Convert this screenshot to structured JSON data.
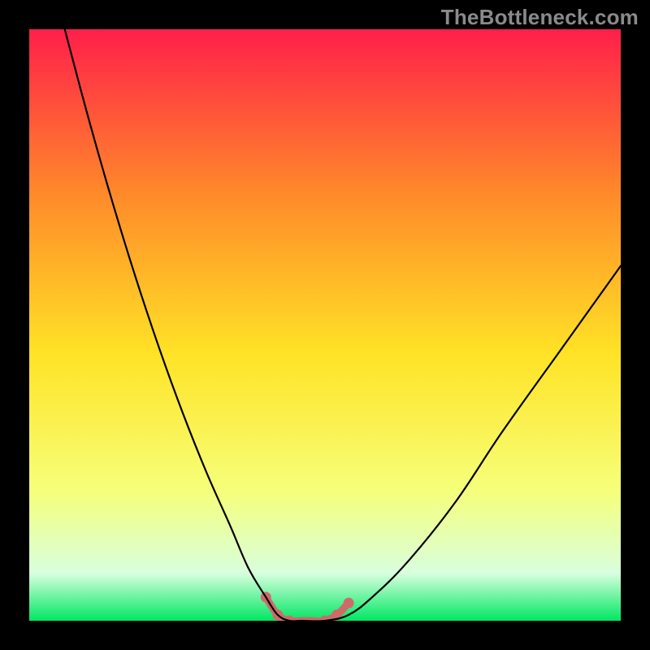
{
  "watermark": {
    "text": "TheBottleneck.com"
  },
  "chart_data": {
    "type": "line",
    "title": "",
    "xlabel": "",
    "ylabel": "",
    "xlim": [
      0,
      100
    ],
    "ylim": [
      0,
      100
    ],
    "background_gradient": {
      "top": "#ff1f4a",
      "mid_upper": "#ff8a2a",
      "mid": "#ffe326",
      "mid_lower": "#f6ff7a",
      "band": "#d8ffde",
      "bottom": "#00e763"
    },
    "series": [
      {
        "name": "bottleneck-curve",
        "x": [
          6,
          10,
          14,
          18,
          22,
          26,
          30,
          34,
          37,
          40,
          42,
          44,
          46,
          50,
          54,
          58,
          64,
          72,
          80,
          90,
          100
        ],
        "y": [
          100,
          85,
          71,
          58,
          46,
          35,
          25,
          16,
          9,
          4,
          1,
          0,
          0,
          0,
          1,
          4,
          10,
          20,
          32,
          46,
          60
        ]
      }
    ],
    "highlight": {
      "name": "optimal-valley",
      "color": "#cd6b6b",
      "x": [
        40,
        42,
        44,
        46,
        48,
        50,
        52,
        54
      ],
      "y": [
        4,
        1,
        0,
        0,
        0,
        0,
        1,
        3
      ],
      "dots_x": [
        40,
        42,
        44,
        50,
        52,
        54
      ],
      "dots_y": [
        4,
        1,
        0,
        0,
        1,
        3
      ]
    }
  }
}
